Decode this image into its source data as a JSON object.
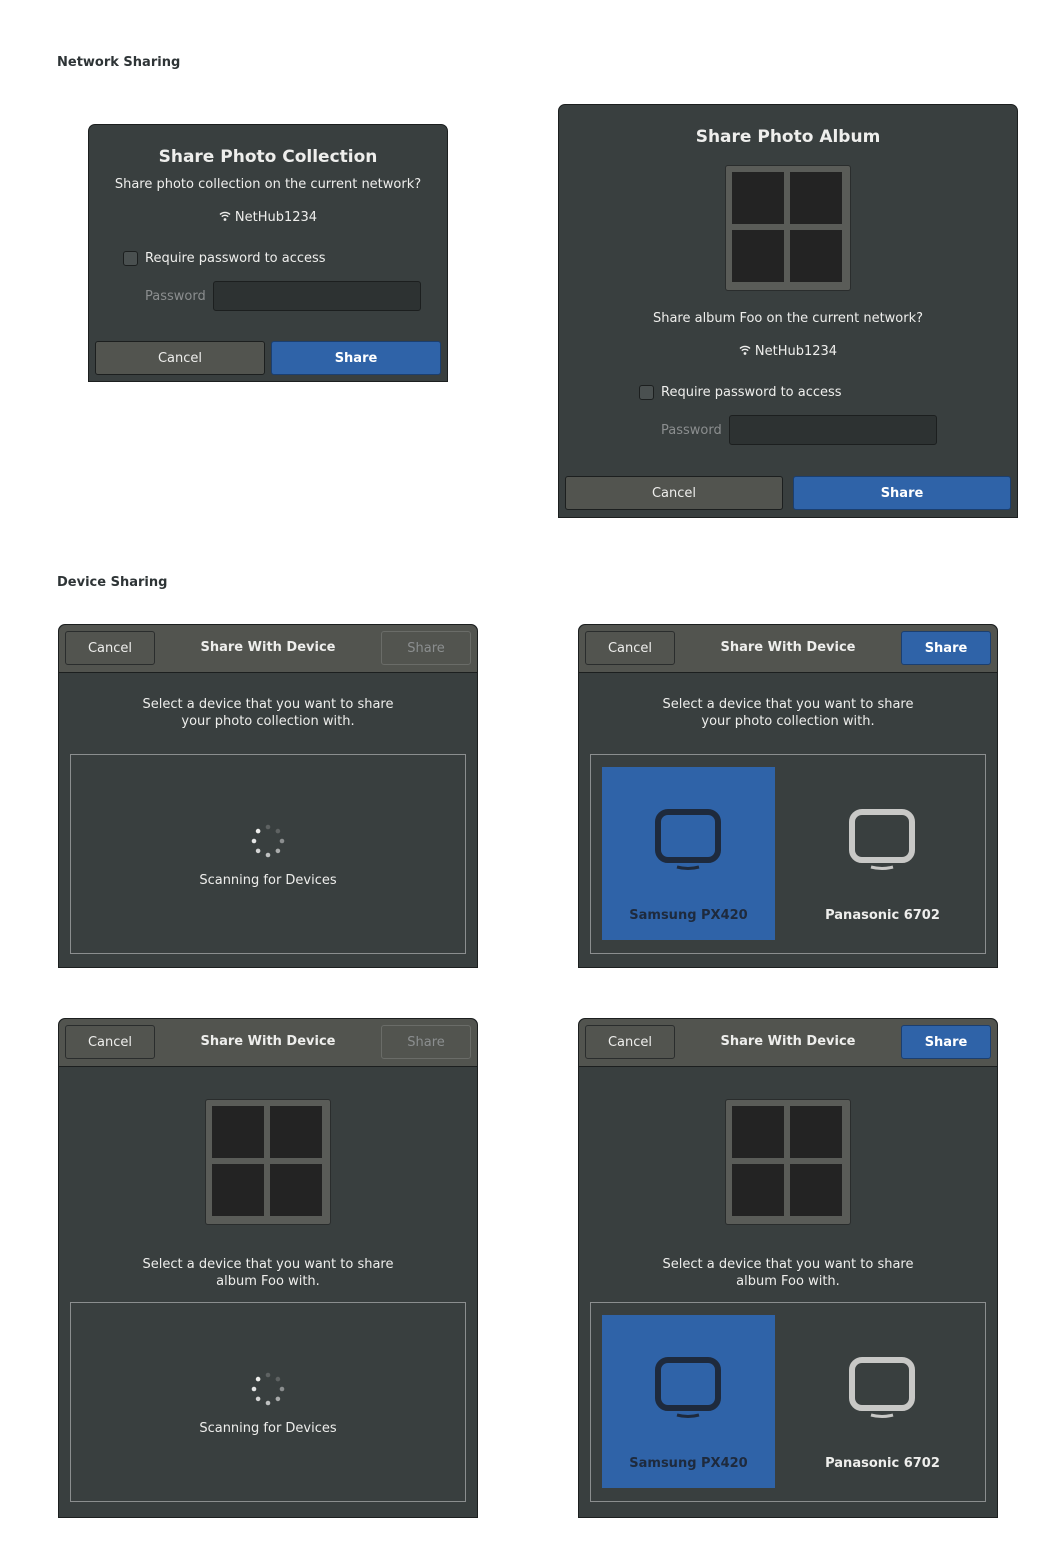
{
  "sections": {
    "network": "Network Sharing",
    "device": "Device Sharing"
  },
  "net1": {
    "title": "Share Photo Collection",
    "question": "Share photo collection on the current network?",
    "network_name": "NetHub1234",
    "require_password": "Require password to access",
    "password_placeholder": "Password",
    "cancel": "Cancel",
    "share": "Share"
  },
  "net2": {
    "title": "Share Photo Album",
    "question": "Share album Foo on the current network?",
    "network_name": "NetHub1234",
    "require_password": "Require password to access",
    "password_placeholder": "Password",
    "cancel": "Cancel",
    "share": "Share"
  },
  "dev1": {
    "cancel": "Cancel",
    "title": "Share With Device",
    "share": "Share",
    "prompt_line1": "Select a device that you want to share",
    "prompt_line2": "your photo collection with.",
    "scanning": "Scanning for Devices"
  },
  "dev2": {
    "cancel": "Cancel",
    "title": "Share With Device",
    "share": "Share",
    "prompt_line1": "Select a device that you want to share",
    "prompt_line2": "your photo collection with.",
    "devices": [
      "Samsung PX420",
      "Panasonic 6702"
    ]
  },
  "dev3": {
    "cancel": "Cancel",
    "title": "Share With Device",
    "share": "Share",
    "prompt_line1": "Select a device that you want to share",
    "prompt_line2": "album Foo with.",
    "scanning": "Scanning for Devices"
  },
  "dev4": {
    "cancel": "Cancel",
    "title": "Share With Device",
    "share": "Share",
    "prompt_line1": "Select a device that you want to share",
    "prompt_line2": "album Foo with.",
    "devices": [
      "Samsung PX420",
      "Panasonic 6702"
    ]
  },
  "colors": {
    "accent": "#2f63a8",
    "dialog_bg": "#393f3f",
    "headerbar_bg": "#52544f"
  },
  "icons": {
    "network": "wifi-icon",
    "device": "tv-monitor-icon",
    "album": "album-grid-icon",
    "loading": "spinner-icon"
  }
}
